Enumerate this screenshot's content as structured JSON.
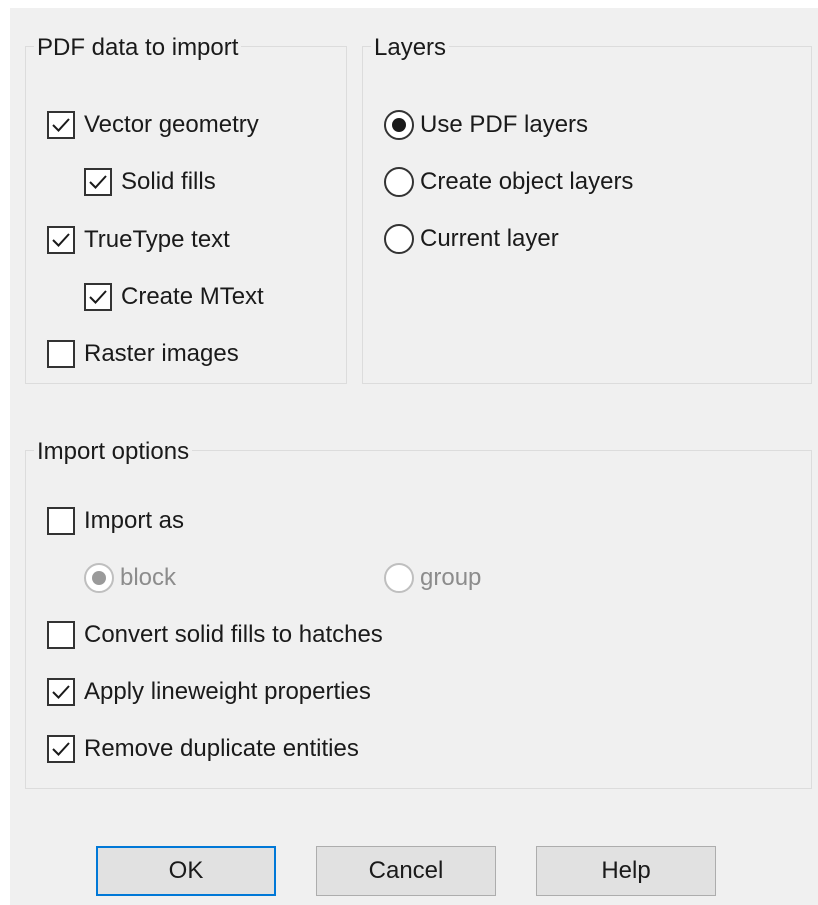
{
  "pdf_data": {
    "legend": "PDF data to import",
    "vector_geometry": {
      "label": "Vector geometry",
      "checked": true
    },
    "solid_fills": {
      "label": "Solid fills",
      "checked": true
    },
    "truetype_text": {
      "label": "TrueType text",
      "checked": true
    },
    "create_mtext": {
      "label": "Create MText",
      "checked": true
    },
    "raster_images": {
      "label": "Raster images",
      "checked": false
    }
  },
  "layers": {
    "legend": "Layers",
    "use_pdf_layers": {
      "label": "Use PDF layers",
      "selected": true
    },
    "create_object_layers": {
      "label": "Create object layers",
      "selected": false
    },
    "current_layer": {
      "label": "Current layer",
      "selected": false
    }
  },
  "import_options": {
    "legend": "Import options",
    "import_as": {
      "label": "Import as",
      "checked": false
    },
    "block": {
      "label": "block",
      "selected": true,
      "enabled": false
    },
    "group": {
      "label": "group",
      "selected": false,
      "enabled": false
    },
    "convert_solid_fills": {
      "label": "Convert solid fills to hatches",
      "checked": false
    },
    "apply_lineweight": {
      "label": "Apply lineweight properties",
      "checked": true
    },
    "remove_duplicates": {
      "label": "Remove duplicate entities",
      "checked": true
    }
  },
  "buttons": {
    "ok": "OK",
    "cancel": "Cancel",
    "help": "Help"
  },
  "colors": {
    "dialog_bg": "#f0f0f0",
    "default_button_border": "#0078d7",
    "disabled_text": "#8c8c8c"
  },
  "icons": {
    "check": "check-mark",
    "radio": "radio-dot"
  }
}
